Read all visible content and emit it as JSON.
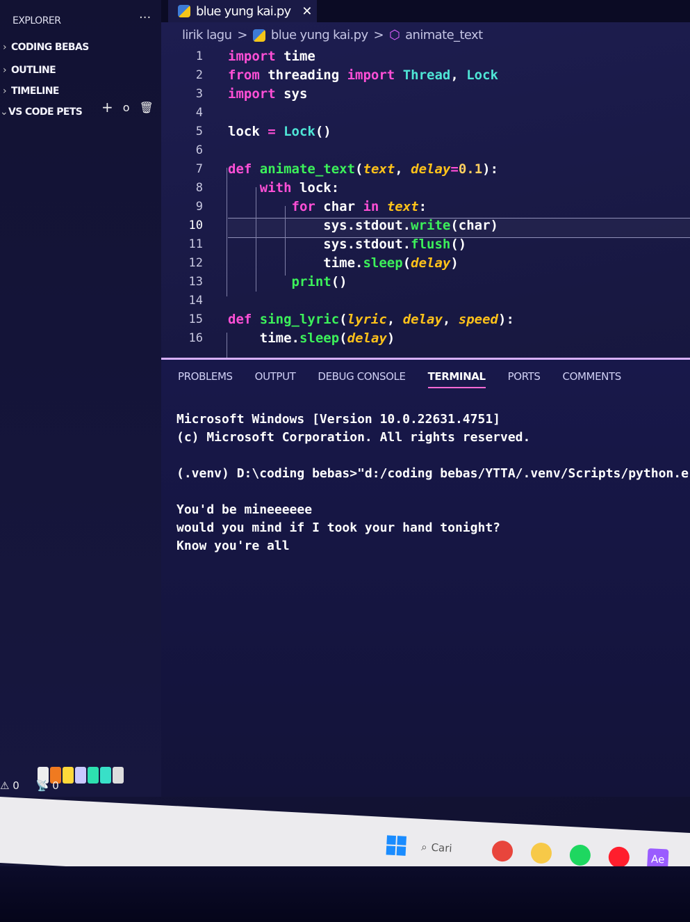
{
  "sidebar": {
    "title": "EXPLORER",
    "more": "...",
    "sections": [
      {
        "label": "CODING BEBAS",
        "expanded": false
      },
      {
        "label": "OUTLINE",
        "expanded": false
      },
      {
        "label": "TIMELINE",
        "expanded": false
      },
      {
        "label": "VS CODE PETS",
        "expanded": true
      }
    ],
    "pets_tools": {
      "add": "+",
      "ball": "o",
      "delete": "🗑"
    }
  },
  "status": {
    "warnings": "0",
    "ports": "0"
  },
  "tab": {
    "label": "blue yung kai.py",
    "close": "✕"
  },
  "breadcrumb": {
    "folder": "lirik lagu",
    "file": "blue yung kai.py",
    "symbol": "animate_text",
    "sep": ">"
  },
  "editor": {
    "current_line": 10,
    "lines": [
      {
        "n": "1",
        "indent": "",
        "tokens": [
          [
            "import",
            "k"
          ],
          [
            " time",
            "n"
          ]
        ]
      },
      {
        "n": "2",
        "indent": "",
        "tokens": [
          [
            "from",
            "k"
          ],
          [
            " threading ",
            "n"
          ],
          [
            "import",
            "k"
          ],
          [
            " Thread",
            "c"
          ],
          [
            ", ",
            "n"
          ],
          [
            "Lock",
            "c"
          ]
        ]
      },
      {
        "n": "3",
        "indent": "",
        "tokens": [
          [
            "import",
            "k"
          ],
          [
            " sys",
            "n"
          ]
        ]
      },
      {
        "n": "4",
        "indent": "",
        "tokens": []
      },
      {
        "n": "5",
        "indent": "",
        "tokens": [
          [
            "lock ",
            "n"
          ],
          [
            "= ",
            "k"
          ],
          [
            "Lock",
            "c"
          ],
          [
            "()",
            "n"
          ]
        ]
      },
      {
        "n": "6",
        "indent": "",
        "tokens": []
      },
      {
        "n": "7",
        "indent": "",
        "tokens": [
          [
            "def ",
            "k"
          ],
          [
            "animate_text",
            "f"
          ],
          [
            "(",
            "n"
          ],
          [
            "text",
            "p"
          ],
          [
            ", ",
            "n"
          ],
          [
            "delay",
            "p"
          ],
          [
            "=",
            "k"
          ],
          [
            "0.1",
            "num"
          ],
          [
            "):",
            "n"
          ]
        ]
      },
      {
        "n": "8",
        "indent": "    ",
        "tokens": [
          [
            "with ",
            "k"
          ],
          [
            "lock:",
            "n"
          ]
        ]
      },
      {
        "n": "9",
        "indent": "        ",
        "tokens": [
          [
            "for ",
            "k"
          ],
          [
            "char ",
            "n"
          ],
          [
            "in ",
            "k"
          ],
          [
            "text",
            "p"
          ],
          [
            ":",
            "n"
          ]
        ]
      },
      {
        "n": "10",
        "indent": "            ",
        "tokens": [
          [
            "sys.stdout.",
            "n"
          ],
          [
            "write",
            "f"
          ],
          [
            "(char)",
            "n"
          ]
        ]
      },
      {
        "n": "11",
        "indent": "            ",
        "tokens": [
          [
            "sys.stdout.",
            "n"
          ],
          [
            "flush",
            "f"
          ],
          [
            "()",
            "n"
          ]
        ]
      },
      {
        "n": "12",
        "indent": "            ",
        "tokens": [
          [
            "time.",
            "n"
          ],
          [
            "sleep",
            "f"
          ],
          [
            "(",
            "n"
          ],
          [
            "delay",
            "p"
          ],
          [
            ")",
            "n"
          ]
        ]
      },
      {
        "n": "13",
        "indent": "        ",
        "tokens": [
          [
            "print",
            "f"
          ],
          [
            "()",
            "n"
          ]
        ]
      },
      {
        "n": "14",
        "indent": "",
        "tokens": []
      },
      {
        "n": "15",
        "indent": "",
        "tokens": [
          [
            "def ",
            "k"
          ],
          [
            "sing_lyric",
            "f"
          ],
          [
            "(",
            "n"
          ],
          [
            "lyric",
            "p"
          ],
          [
            ", ",
            "n"
          ],
          [
            "delay",
            "p"
          ],
          [
            ", ",
            "n"
          ],
          [
            "speed",
            "p"
          ],
          [
            "):",
            "n"
          ]
        ]
      },
      {
        "n": "16",
        "indent": "    ",
        "tokens": [
          [
            "time.",
            "n"
          ],
          [
            "sleep",
            "f"
          ],
          [
            "(",
            "n"
          ],
          [
            "delay",
            "p"
          ],
          [
            ")",
            "n"
          ]
        ]
      }
    ]
  },
  "panel": {
    "tabs": [
      "PROBLEMS",
      "OUTPUT",
      "DEBUG CONSOLE",
      "TERMINAL",
      "PORTS",
      "COMMENTS"
    ],
    "active_tab": "TERMINAL",
    "terminal": [
      "Microsoft Windows [Version 10.0.22631.4751]",
      "(c) Microsoft Corporation. All rights reserved.",
      "",
      "(.venv) D:\\coding bebas>\"d:/coding bebas/YTTA/.venv/Scripts/python.e",
      "",
      "You'd be mineeeeee",
      "would you mind if I took your hand tonight?",
      "Know you're all"
    ]
  },
  "taskbar": {
    "search": "Cari",
    "apps": [
      {
        "name": "chrome",
        "color": "#e8453c"
      },
      {
        "name": "file-explorer",
        "color": "#f7c948"
      },
      {
        "name": "spotify",
        "color": "#1ed760"
      },
      {
        "name": "youtube-music",
        "color": "#ff1e2d"
      },
      {
        "name": "after-effects",
        "label": "Ae",
        "color": "#9a5cff"
      }
    ]
  }
}
